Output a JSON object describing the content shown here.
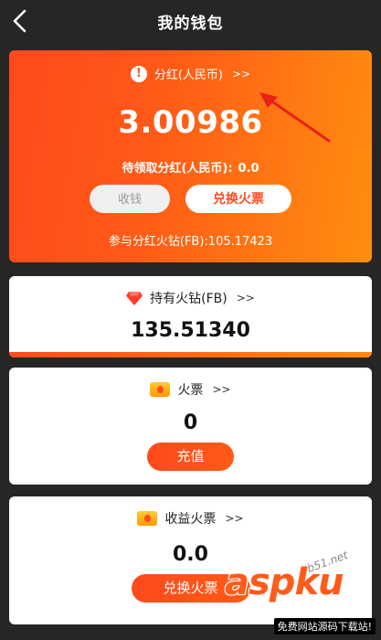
{
  "header": {
    "title": "我的钱包",
    "back_icon": "chevron-left-icon"
  },
  "dividend": {
    "icon": "exclamation-circle-icon",
    "label": "分红(人民币)",
    "more": ">>",
    "amount": "3.00986",
    "pending_label": "待领取分红(人民币):",
    "pending_value": "0.0",
    "collect_label": "收钱",
    "exchange_label": "兑换火票",
    "fb_line": "参与分红火钻(FB):105.17423",
    "colors": {
      "gradient_start": "#ff4a1c",
      "gradient_end": "#ff8e10"
    }
  },
  "diamonds": {
    "icon": "diamond-icon",
    "label": "持有火钻(FB)",
    "more": ">>",
    "value": "135.51340"
  },
  "tickets": {
    "icon": "fire-ticket-icon",
    "label": "火票",
    "more": ">>",
    "value": "0",
    "button_label": "充值"
  },
  "earnings": {
    "icon": "fire-ticket-icon",
    "label": "收益火票",
    "more": ">>",
    "value": "0.0",
    "button_label": "兑换火票"
  },
  "watermark": {
    "logo": "asp",
    "logo2": "ku",
    "site": "jb51.net",
    "sub": "免费网站源码下载站!"
  },
  "accent_color": "#ff4a1c"
}
